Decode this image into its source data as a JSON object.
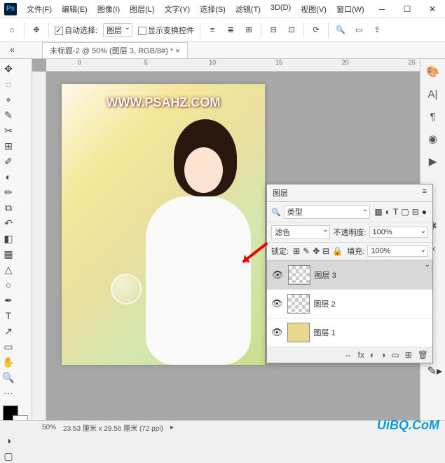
{
  "menu": {
    "file": "文件(F)",
    "edit": "编辑(E)",
    "image": "图像(I)",
    "layer": "图层(L)",
    "text": "文字(Y)",
    "select": "选择(S)",
    "filter": "滤镜(T)",
    "threed": "3D(D)",
    "view": "视图(V)",
    "window": "窗口(W)"
  },
  "optbar": {
    "auto_select": "自动选择:",
    "target": "图层",
    "show_transform": "显示变换控件"
  },
  "tab": {
    "title": "未标题-2 @ 50% (图层 3, RGB/8#) *"
  },
  "ruler": {
    "m0": "0",
    "m5": "5",
    "m10": "10",
    "m15": "15",
    "m20": "20",
    "m25": "25"
  },
  "canvas": {
    "watermark": "WWW.PSAHZ.COM"
  },
  "layers": {
    "panel_title": "图层",
    "kind_label": "类型",
    "blend": "滤色",
    "opacity_label": "不透明度:",
    "opacity_val": "100%",
    "lock_label": "锁定:",
    "fill_label": "填充:",
    "fill_val": "100%",
    "items": [
      {
        "name": "图层 3"
      },
      {
        "name": "图层 2"
      },
      {
        "name": "图层 1"
      }
    ]
  },
  "status": {
    "zoom": "50%",
    "doc": "23.53 厘米 x 29.56 厘米 (72 ppi)"
  },
  "brand": "UiBQ.CoM"
}
